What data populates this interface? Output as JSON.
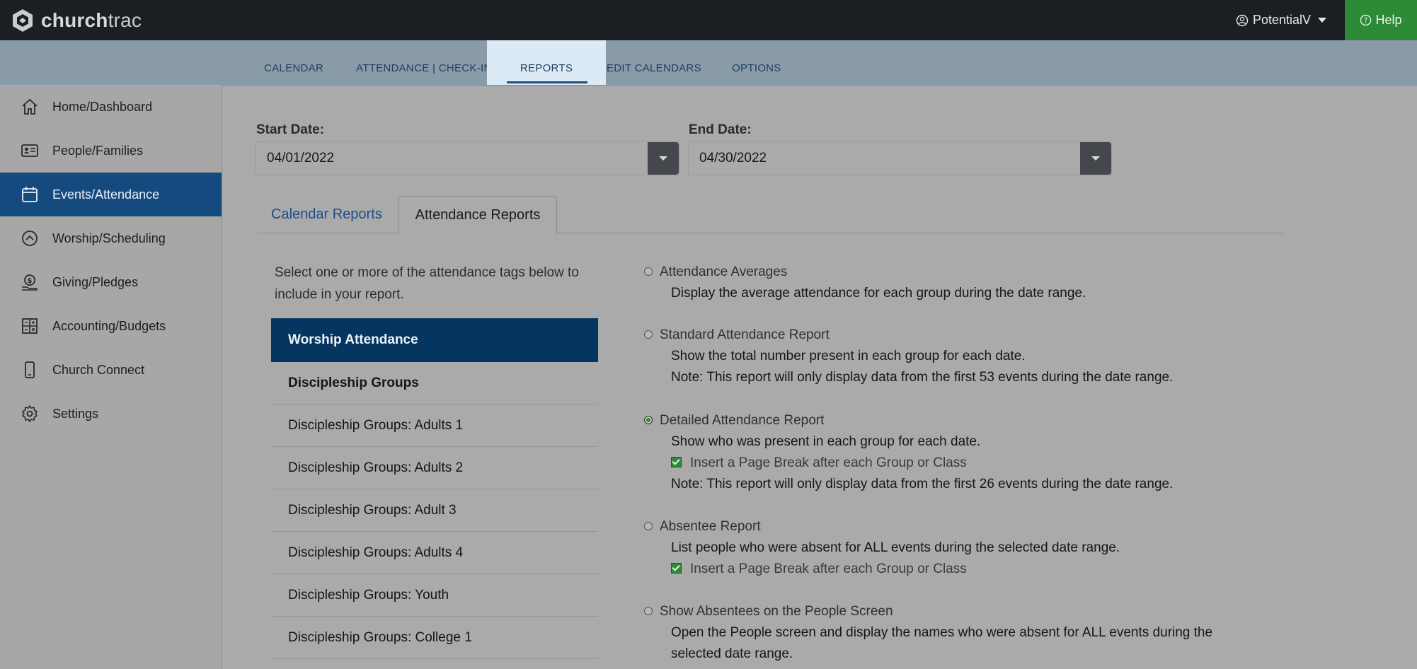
{
  "brand": {
    "name_bold": "church",
    "name_light": "trac"
  },
  "topbar": {
    "user": "PotentialV",
    "help": "Help"
  },
  "subnav": [
    {
      "label": "CALENDAR",
      "active": false
    },
    {
      "label": "ATTENDANCE | CHECK-IN",
      "active": false
    },
    {
      "label": "REPORTS",
      "active": true
    },
    {
      "label": "EDIT CALENDARS",
      "active": false
    },
    {
      "label": "OPTIONS",
      "active": false
    }
  ],
  "sidebar": {
    "items": [
      {
        "label": "Home/Dashboard",
        "icon": "home-icon"
      },
      {
        "label": "People/Families",
        "icon": "id-card-icon"
      },
      {
        "label": "Events/Attendance",
        "icon": "calendar-icon",
        "active": true
      },
      {
        "label": "Worship/Scheduling",
        "icon": "chevron-up-circle-icon"
      },
      {
        "label": "Giving/Pledges",
        "icon": "money-hand-icon"
      },
      {
        "label": "Accounting/Budgets",
        "icon": "ledger-icon"
      },
      {
        "label": "Church Connect",
        "icon": "phone-icon"
      },
      {
        "label": "Settings",
        "icon": "gear-icon"
      }
    ]
  },
  "dates": {
    "start_label": "Start Date:",
    "start_value": "04/01/2022",
    "end_label": "End Date:",
    "end_value": "04/30/2022"
  },
  "tabs": {
    "calendar_reports": "Calendar Reports",
    "attendance_reports": "Attendance Reports"
  },
  "instructions": "Select one or more of the attendance tags below to include in your report.",
  "tags": [
    "Worship Attendance",
    "Discipleship Groups",
    "Discipleship Groups: Adults 1",
    "Discipleship Groups: Adults 2",
    "Discipleship Groups: Adult 3",
    "Discipleship Groups: Adults 4",
    "Discipleship Groups: Youth",
    "Discipleship Groups: College 1"
  ],
  "options": {
    "averages": {
      "title": "Attendance Averages",
      "desc": "Display the average attendance for each group during the date range."
    },
    "standard": {
      "title": "Standard Attendance Report",
      "desc": "Show the total number present in each group for each date.",
      "note": "Note: This report will only display data from the first 53 events during the date range."
    },
    "detailed": {
      "title": "Detailed Attendance Report",
      "desc": "Show who was present in each group for each date.",
      "check": "Insert a Page Break after each Group or Class",
      "note": "Note: This report will only display data from the first 26 events during the date range."
    },
    "absentee": {
      "title": "Absentee Report",
      "desc": "List people who were absent for ALL events during the selected date range.",
      "check": "Insert a Page Break after each Group or Class"
    },
    "people_screen": {
      "title": "Show Absentees on the People Screen",
      "desc1": "Open the People screen and display the names who were absent for ALL events during the",
      "desc2": "selected date range."
    }
  },
  "colors": {
    "topbar": "#1b1f24",
    "help_green": "#2d8a36",
    "active_blue": "#154a7e",
    "selected_tag": "#06355f"
  }
}
